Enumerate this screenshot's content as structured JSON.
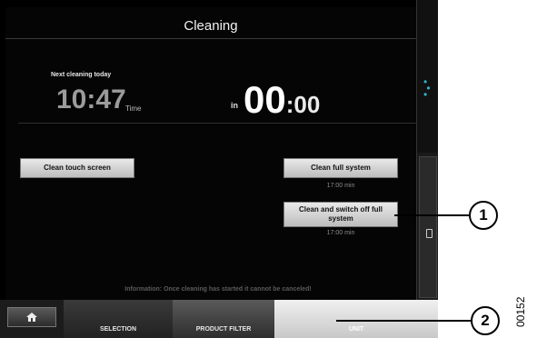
{
  "screen": {
    "title": "Cleaning",
    "next_cleaning_label": "Next cleaning today",
    "next_time": "10:47",
    "time_unit": "Time",
    "in_label": "in",
    "countdown_hours": "00",
    "countdown_minutes": ":00",
    "buttons": {
      "clean_touch_screen": "Clean touch screen",
      "clean_full_system": "Clean full system",
      "clean_full_system_duration": "17:00 min",
      "clean_switch_off": "Clean and switch off full system",
      "clean_switch_off_duration": "17:00 min"
    },
    "info": "Information: Once cleaning has started it cannot be canceled!"
  },
  "nav": {
    "home_icon": "home-icon",
    "selection": "SELECTION",
    "product_filter": "PRODUCT FILTER",
    "unit": "UNIT"
  },
  "sidebar": {
    "drops_icon": "water-drops-icon",
    "bottle_icon": "bottle-icon"
  },
  "callouts": {
    "one": "1",
    "two": "2"
  },
  "doc_id": "00152",
  "colors": {
    "background": "#050505",
    "accent_drops": "#2fb4c8",
    "button": "#d8d8d8"
  }
}
